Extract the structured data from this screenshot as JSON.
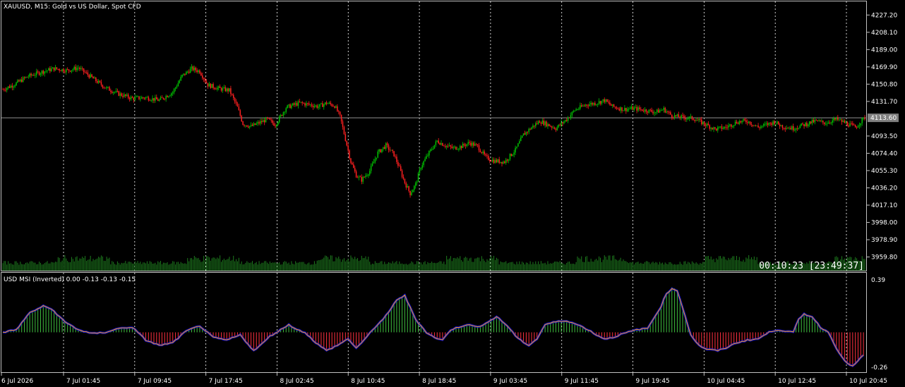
{
  "symbol_label": "XAUUSD, M15:  Gold vs US Dollar, Spot CFD",
  "indicator_label": "USD MSI (Inverted) 0.00 -0.13 -0.13 -0.15",
  "timer_label": "00:10:23 [23:49:37]",
  "colors": {
    "background": "#000000",
    "bull": "#00c000",
    "bear": "#ff2020",
    "volume": "#1e7d1e",
    "grid": "#ffffff",
    "current_price_line": "#808080",
    "hist_pos": "#3fbf3f",
    "hist_neg": "#ff3040",
    "msi_line": "#ffa500",
    "msi_dots": "#1010ff"
  },
  "chart_data": [
    {
      "type": "candlestick",
      "panel": "price",
      "symbol": "XAUUSD",
      "timeframe": "M15",
      "y_ticks": [
        "4227.20",
        "4208.10",
        "4189.00",
        "4169.90",
        "4150.80",
        "4131.70",
        "4093.50",
        "4074.40",
        "4055.30",
        "4036.20",
        "4017.10",
        "3998.00",
        "3978.90",
        "3959.80"
      ],
      "ylim": [
        3954,
        4236
      ],
      "current_price": "4113.60",
      "x_ticks": [
        "6 Jul 2026",
        "7 Jul 01:45",
        "7 Jul 09:45",
        "7 Jul 17:45",
        "8 Jul 02:45",
        "8 Jul 10:45",
        "8 Jul 18:45",
        "9 Jul 03:45",
        "9 Jul 11:45",
        "9 Jul 19:45",
        "10 Jul 04:45",
        "10 Jul 12:45",
        "10 Jul 20:45"
      ],
      "close_path": [
        [
          0,
          4145
        ],
        [
          8,
          4150
        ],
        [
          18,
          4159
        ],
        [
          28,
          4164
        ],
        [
          38,
          4168
        ],
        [
          48,
          4166
        ],
        [
          56,
          4169
        ],
        [
          66,
          4158
        ],
        [
          76,
          4147
        ],
        [
          86,
          4140
        ],
        [
          96,
          4135
        ],
        [
          106,
          4136
        ],
        [
          116,
          4133
        ],
        [
          126,
          4142
        ],
        [
          133,
          4160
        ],
        [
          140,
          4168
        ],
        [
          146,
          4165
        ],
        [
          152,
          4150
        ],
        [
          160,
          4146
        ],
        [
          168,
          4144
        ],
        [
          174,
          4125
        ],
        [
          178,
          4107
        ],
        [
          184,
          4104
        ],
        [
          190,
          4108
        ],
        [
          196,
          4112
        ],
        [
          202,
          4106
        ],
        [
          210,
          4125
        ],
        [
          220,
          4130
        ],
        [
          228,
          4128
        ],
        [
          234,
          4126
        ],
        [
          240,
          4130
        ],
        [
          246,
          4127
        ],
        [
          250,
          4115
        ],
        [
          254,
          4090
        ],
        [
          258,
          4065
        ],
        [
          262,
          4050
        ],
        [
          266,
          4045
        ],
        [
          272,
          4055
        ],
        [
          278,
          4075
        ],
        [
          284,
          4083
        ],
        [
          290,
          4073
        ],
        [
          294,
          4058
        ],
        [
          298,
          4042
        ],
        [
          302,
          4030
        ],
        [
          306,
          4040
        ],
        [
          310,
          4060
        ],
        [
          316,
          4075
        ],
        [
          322,
          4088
        ],
        [
          328,
          4083
        ],
        [
          334,
          4080
        ],
        [
          340,
          4082
        ],
        [
          346,
          4086
        ],
        [
          352,
          4082
        ],
        [
          358,
          4070
        ],
        [
          364,
          4066
        ],
        [
          372,
          4065
        ],
        [
          380,
          4078
        ],
        [
          386,
          4095
        ],
        [
          392,
          4103
        ],
        [
          398,
          4110
        ],
        [
          404,
          4106
        ],
        [
          410,
          4102
        ],
        [
          418,
          4112
        ],
        [
          424,
          4122
        ],
        [
          432,
          4128
        ],
        [
          440,
          4130
        ],
        [
          446,
          4133
        ],
        [
          452,
          4126
        ],
        [
          460,
          4123
        ],
        [
          468,
          4124
        ],
        [
          476,
          4122
        ],
        [
          484,
          4120
        ],
        [
          490,
          4123
        ],
        [
          496,
          4116
        ],
        [
          504,
          4114
        ],
        [
          512,
          4113
        ],
        [
          520,
          4107
        ],
        [
          528,
          4101
        ],
        [
          536,
          4103
        ],
        [
          544,
          4109
        ],
        [
          552,
          4110
        ],
        [
          560,
          4103
        ],
        [
          566,
          4106
        ],
        [
          572,
          4109
        ],
        [
          578,
          4104
        ],
        [
          586,
          4102
        ],
        [
          594,
          4106
        ],
        [
          602,
          4110
        ],
        [
          610,
          4108
        ],
        [
          618,
          4112
        ],
        [
          626,
          4107
        ],
        [
          632,
          4103
        ],
        [
          639,
          4114
        ]
      ],
      "volume_note": "green tick-volume bars along bottom of price panel"
    },
    {
      "type": "histogram+line",
      "panel": "indicator",
      "name": "USD MSI (Inverted)",
      "values_shown": [
        "0.00",
        "-0.13",
        "-0.13",
        "-0.15"
      ],
      "y_ticks": [
        "0.39",
        "-0.26"
      ],
      "ylim": [
        -0.28,
        0.41
      ],
      "series": [
        {
          "kind": "histogram",
          "x": [
            0,
            10,
            20,
            30,
            36,
            46,
            56,
            66,
            76,
            86,
            96,
            106,
            116,
            126,
            136,
            146,
            156,
            166,
            176,
            186,
            192,
            198,
            206,
            212,
            218,
            224,
            232,
            240,
            248,
            256,
            262,
            268,
            274,
            280,
            286,
            292,
            298,
            306,
            314,
            320,
            326,
            332,
            338,
            344,
            352,
            360,
            366,
            374,
            382,
            390,
            396,
            402,
            410,
            418,
            428,
            434,
            440,
            446,
            452,
            460,
            470,
            478,
            488,
            492,
            496,
            500,
            506,
            510,
            516,
            522,
            530,
            536,
            544,
            552,
            560,
            568,
            574,
            580,
            586,
            590,
            594,
            600,
            606,
            612,
            618,
            624,
            630,
            634,
            639
          ],
          "values": [
            0.0,
            0.02,
            0.15,
            0.2,
            0.18,
            0.08,
            0.02,
            -0.01,
            0.0,
            0.03,
            0.04,
            -0.06,
            -0.1,
            -0.08,
            0.01,
            0.05,
            -0.04,
            -0.06,
            -0.02,
            -0.14,
            -0.09,
            -0.03,
            0.02,
            0.06,
            0.02,
            0.0,
            -0.08,
            -0.14,
            -0.1,
            -0.05,
            -0.12,
            -0.06,
            0.02,
            0.08,
            0.15,
            0.25,
            0.28,
            0.1,
            0.0,
            -0.04,
            -0.06,
            0.02,
            0.04,
            0.06,
            0.04,
            0.08,
            0.12,
            0.05,
            -0.05,
            -0.1,
            -0.05,
            0.06,
            0.08,
            0.09,
            0.05,
            0.02,
            -0.02,
            -0.05,
            -0.04,
            -0.01,
            0.02,
            0.03,
            0.2,
            0.3,
            0.33,
            0.32,
            0.12,
            -0.02,
            -0.1,
            -0.13,
            -0.14,
            -0.12,
            -0.08,
            -0.06,
            -0.05,
            0.0,
            0.02,
            0.01,
            0.0,
            0.1,
            0.14,
            0.12,
            0.04,
            0.0,
            -0.12,
            -0.22,
            -0.26,
            -0.22,
            -0.16
          ]
        },
        {
          "kind": "line",
          "note": "smoothed MSI line drawn over histogram"
        }
      ]
    }
  ]
}
